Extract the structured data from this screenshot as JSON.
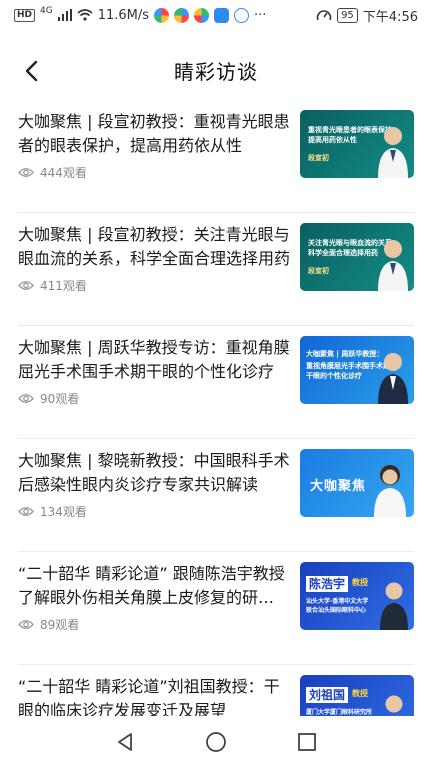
{
  "status_bar": {
    "hd": "HD",
    "signal": "4G",
    "net_speed": "11.6M/s",
    "dots": "···",
    "battery": "95",
    "time": "下午4:56"
  },
  "header": {
    "title": "睛彩访谈"
  },
  "articles": [
    {
      "title": "大咖聚焦 | 段宣初教授：重视青光眼患者的眼表保护，提高用药依从性",
      "views": "444观看",
      "thumb": {
        "lines": [
          "重视青光眼患者的眼表保护",
          "提高用药依从性"
        ],
        "name": "段宣初"
      }
    },
    {
      "title": "大咖聚焦 | 段宣初教授：关注青光眼与眼血流的关系，科学全面合理选择用药",
      "views": "411观看",
      "thumb": {
        "lines": [
          "关注青光眼与眼血流的关系",
          "科学全面合理选择用药"
        ],
        "name": "段宣初"
      }
    },
    {
      "title": "大咖聚焦 | 周跃华教授专访：重视角膜屈光手术围手术期干眼的个性化诊疗",
      "views": "90观看",
      "thumb": {
        "lines": [
          "大咖聚焦 | 周跃华教授：",
          "重视角膜屈光手术围手术期",
          "干眼的个性化诊疗"
        ],
        "name": ""
      }
    },
    {
      "title": "大咖聚焦 | 黎晓新教授：中国眼科手术后感染性眼内炎诊疗专家共识解读",
      "views": "134观看",
      "thumb": {
        "lines": [
          "大咖聚焦"
        ],
        "name": ""
      }
    },
    {
      "title": "“二十韶华 睛彩论道” 跟随陈浩宇教授了解眼外伤相关角膜上皮修复的研究进展",
      "views": "89观看",
      "thumb": {
        "lines": [
          "陈浩宇",
          "教授",
          "汕头大学·香港中文大学",
          "联合汕头国际眼科中心"
        ],
        "name": ""
      }
    },
    {
      "title": "“二十韶华 睛彩论道”刘祖国教授：干眼的临床诊疗发展变迁及展望",
      "views": "",
      "thumb": {
        "lines": [
          "刘祖国",
          "教授",
          "厦门大学厦门眼科研究所"
        ],
        "name": ""
      }
    }
  ],
  "colors": {
    "teal_bg": "#0f6b6b",
    "blue_bg": "#1a73d8",
    "deep_blue_bg": "#1d3fbf",
    "accent_yellow": "#ffd33d"
  }
}
